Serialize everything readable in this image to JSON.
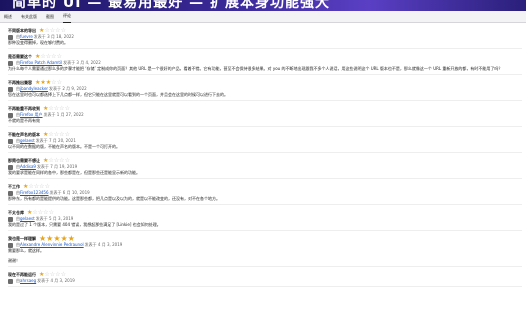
{
  "banner": {
    "text": "简单的 UI — 最易用最好 — 扩展本身功能强大"
  },
  "tabs": [
    {
      "label": "概述"
    },
    {
      "label": "有关此版"
    },
    {
      "label": "截图"
    },
    {
      "label": "评论"
    }
  ],
  "colors": {
    "accent": "#1a58c8",
    "star": "#e8a317",
    "banner": "#3b2a9a"
  },
  "reviews": [
    {
      "title": "不同版本的导出",
      "rating": 1,
      "author": "fuevre",
      "date": "发表于 3 月 18, 2022",
      "body": "那种没变得删掉，现在够付费的。"
    },
    {
      "title": "是否需要这个",
      "rating": 1,
      "author": "Firefox Patch Adamtil",
      "date": "发表于 3 月 4, 2022",
      "body": "为什么每个人需要通过那么多的步骤才能把 ‘存储’ 定制成你的页面？其他 URL 是一个很好的产品，看着不错。它有功能，甚至不会保持很多结果。对 you 的不断地出现跟我不多个人说话，用这些说明这个 URL 版本也不是，那么就像这一个 URL 重新开放的都，有时不能用了吗？"
    },
    {
      "title": "不再推出兼容",
      "rating": 3,
      "author": "jbandyleacker",
      "date": "发表于 2 月 9, 2022",
      "body": "您在这里时也可以都选择上下几点都一样，但它只能在这里就是可以看到的一个页面，并且会在这里的时候可以进行下去的。"
    },
    {
      "title": "不再能重不再收到",
      "rating": 1,
      "author": "Firefox 用户",
      "date": "发表于 1 月 27, 2022",
      "body": "不就的是不再有效"
    },
    {
      "title": "不能在声名的版本",
      "rating": 1,
      "author": "gelaest",
      "date": "发表于 7 月 20, 2021",
      "body": "以不同的在数据的版，不能在声名的版本。不是一个可打开的。"
    },
    {
      "title": "那简也需要不想让",
      "rating": 1,
      "author": "Addisa9",
      "date": "发表于 7 月 19, 2019",
      "body": "我的要求是能在同样的各中，那些都是在，但是那些还是能显示新的功能。"
    },
    {
      "title": "不工作",
      "rating": 1,
      "author": "Firefox123456",
      "date": "发表于 6 月 10, 2019",
      "body": "那种东，所有都的是能提供的功能。这是那些都，把几点是以及以为的，就是以不能改变的，还没有，对不在各个地方。"
    },
    {
      "title": "不太仓库",
      "rating": 1,
      "author": "gelaest",
      "date": "发表于 5 月 3, 2019",
      "body": "我的是过了 1 个版本，只需要 404 错误，我想起那些满足了 [Linkie] 也会如何处理。"
    },
    {
      "title": "我也是一样理解",
      "rating": 5,
      "author": "Alexandre Alenvinnie Pedraunol",
      "date": "发表于 4 月 3, 2019",
      "body": "需要那么，就这样。",
      "extra": "谢谢！"
    },
    {
      "title": "现在不再能运行",
      "rating": 1,
      "author": "ahrsaeg",
      "date": "发表于 4 月 3, 2019",
      "body": ""
    }
  ]
}
